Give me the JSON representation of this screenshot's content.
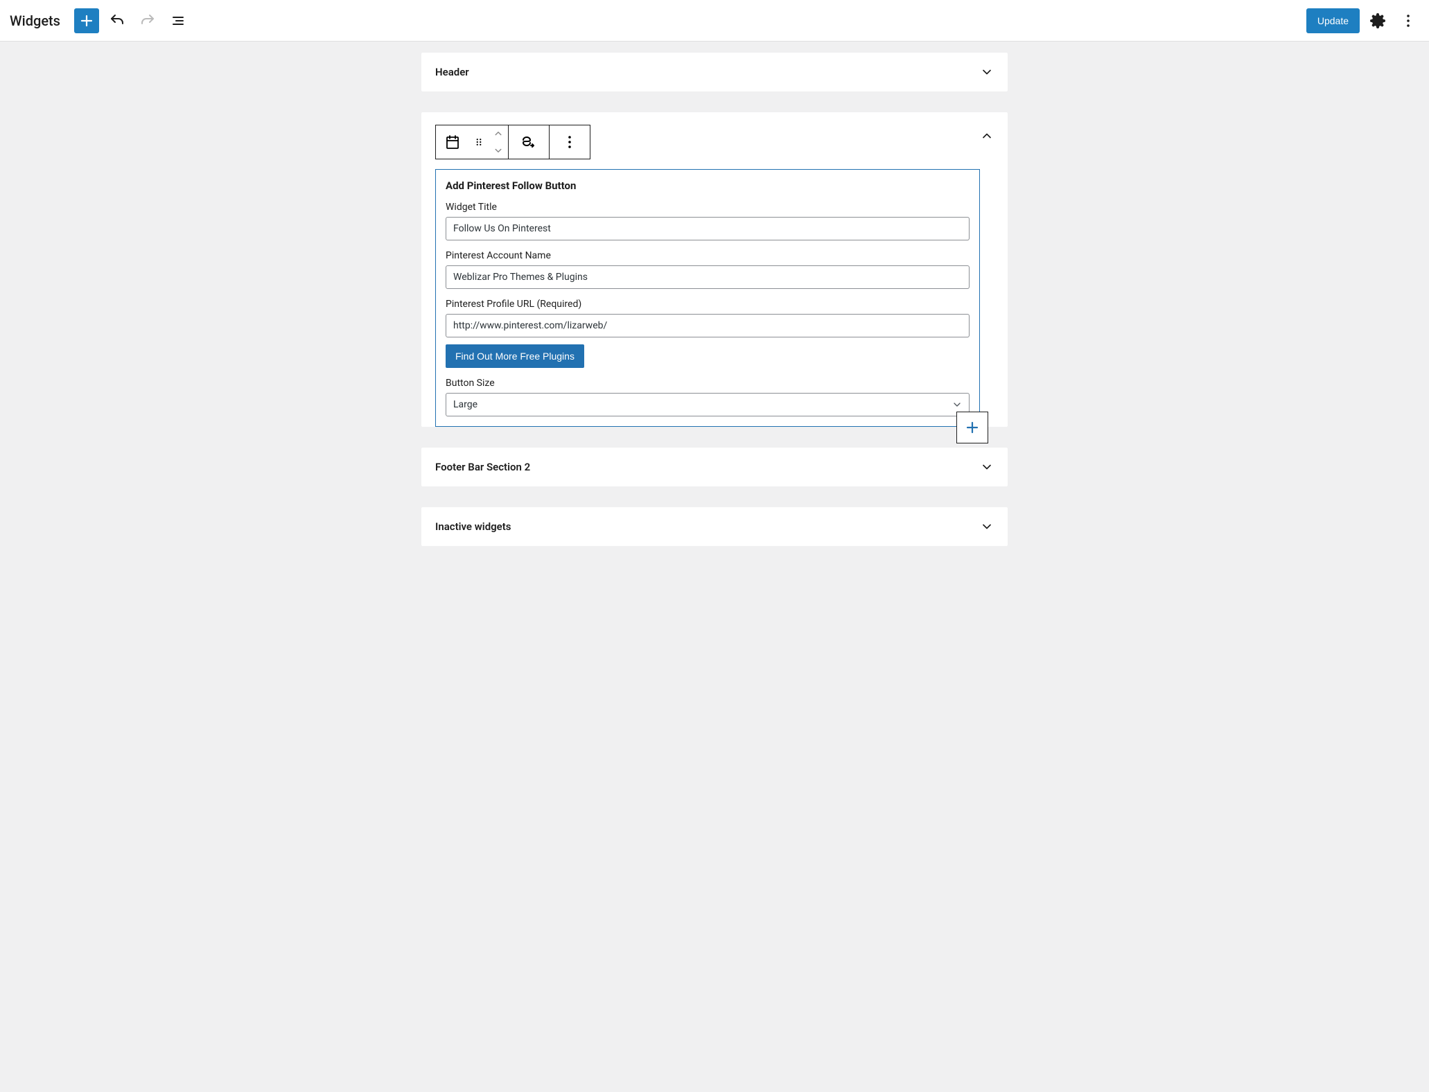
{
  "header": {
    "page_title": "Widgets",
    "update_label": "Update"
  },
  "panels": {
    "header_area": {
      "title": "Header"
    },
    "footer_bar_2": {
      "title": "Footer Bar Section 2"
    },
    "inactive": {
      "title": "Inactive widgets"
    }
  },
  "widget_block": {
    "heading": "Add Pinterest Follow Button",
    "fields": {
      "widget_title": {
        "label": "Widget Title",
        "value": "Follow Us On Pinterest"
      },
      "account_name": {
        "label": "Pinterest Account Name",
        "value": "Weblizar Pro Themes & Plugins"
      },
      "profile_url": {
        "label": "Pinterest Profile URL (Required)",
        "value": "http://www.pinterest.com/lizarweb/"
      },
      "button_size": {
        "label": "Button Size",
        "value": "Large"
      }
    },
    "more_plugins_label": "Find Out More Free Plugins"
  },
  "colors": {
    "primary": "#1e7fc1",
    "wp_blue": "#2271b1"
  },
  "icons": {
    "plus": "plus-icon",
    "undo": "undo-icon",
    "redo": "redo-icon",
    "list": "list-view-icon",
    "gear": "settings-icon",
    "more": "more-vertical-icon",
    "calendar": "calendar-icon",
    "drag": "drag-handle-icon",
    "move_up": "move-up-icon",
    "move_down": "move-down-icon",
    "transform": "transform-icon",
    "chevron_down": "chevron-down-icon",
    "chevron_up": "chevron-up-icon"
  }
}
